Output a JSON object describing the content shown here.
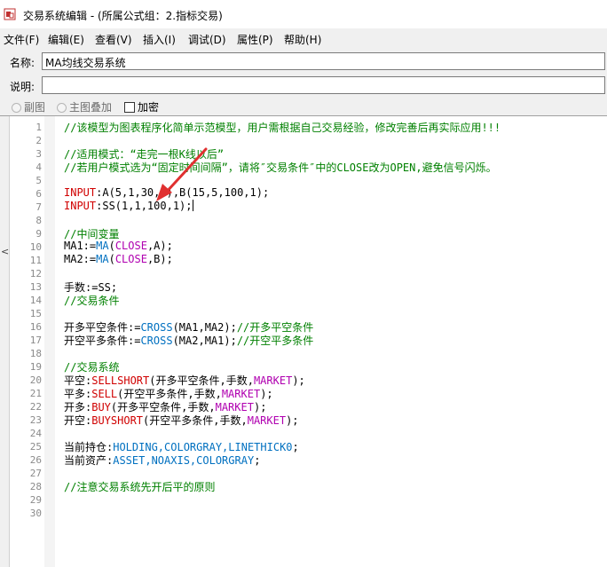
{
  "window": {
    "title": "交易系统编辑 - (所属公式组：2.指标交易)"
  },
  "menu": [
    {
      "label": "文件(F)"
    },
    {
      "label": "编辑(E)"
    },
    {
      "label": "查看(V)"
    },
    {
      "label": "插入(I)"
    },
    {
      "label": "调试(D)"
    },
    {
      "label": "属性(P)"
    },
    {
      "label": "帮助(H)"
    }
  ],
  "form": {
    "name_label": "名称:",
    "name_value": "MA均线交易系统",
    "desc_label": "说明:",
    "desc_value": "",
    "opt_subchart": "副图",
    "opt_mainoverlay": "主图叠加",
    "opt_encrypt": "加密"
  },
  "editor": {
    "line_numbers": [
      "1",
      "2",
      "3",
      "4",
      "5",
      "6",
      "7",
      "8",
      "9",
      "10",
      "11",
      "12",
      "13",
      "14",
      "15",
      "16",
      "17",
      "18",
      "19",
      "20",
      "21",
      "22",
      "23",
      "24",
      "25",
      "26",
      "27",
      "28",
      "29",
      "30"
    ],
    "line1": "//该模型为图表程序化简单示范模型，用户需根据自己交易经验，修改完善后再实际应用!!!",
    "line3": "//适用模式：“走完一根K线以后”",
    "line4": "//若用户模式选为“固定时间间隔”，请将″交易条件″中的CLOSE改为OPEN,避免信号闪烁。",
    "line6_kw": "INPUT",
    "line6_rest": ":A(5,1,30,1),B(15,5,100,1);",
    "line7_kw": "INPUT",
    "line7_rest": ":SS(1,1,100,1);",
    "line9": "//中间变量",
    "line10_a": "MA1:=",
    "line10_fn": "MA",
    "line10_b": "(",
    "line10_c": "CLOSE",
    "line10_d": ",A);",
    "line11_a": "MA2:=",
    "line11_fn": "MA",
    "line11_b": "(",
    "line11_c": "CLOSE",
    "line11_d": ",B);",
    "line13": "手数:=SS;",
    "line14": "//交易条件",
    "line16_a": "开多平空条件:=",
    "line16_fn": "CROSS",
    "line16_b": "(MA1,MA2);",
    "line16_c": "//开多平空条件",
    "line17_a": "开空平多条件:=",
    "line17_fn": "CROSS",
    "line17_b": "(MA2,MA1);",
    "line17_c": "//开空平多条件",
    "line19": "//交易系统",
    "line20_a": "平空:",
    "line20_fn": "SELLSHORT",
    "line20_b": "(开多平空条件,手数,",
    "line20_c": "MARKET",
    "line20_d": ");",
    "line21_a": "平多:",
    "line21_fn": "SELL",
    "line21_b": "(开空平多条件,手数,",
    "line21_c": "MARKET",
    "line21_d": ");",
    "line22_a": "开多:",
    "line22_fn": "BUY",
    "line22_b": "(开多平空条件,手数,",
    "line22_c": "MARKET",
    "line22_d": ");",
    "line23_a": "开空:",
    "line23_fn": "BUYSHORT",
    "line23_b": "(开空平多条件,手数,",
    "line23_c": "MARKET",
    "line23_d": ");",
    "line25_a": "当前持仓:",
    "line25_b": "HOLDING,COLORGRAY,LINETHICK0",
    "line25_c": ";",
    "line26_a": "当前资产:",
    "line26_b": "ASSET,NOAXIS,COLORGRAY",
    "line26_c": ";",
    "line28": "//注意交易系统先开后平的原则"
  },
  "colors": {
    "comment": "#008000",
    "keyword_red": "#d00000",
    "function_blue": "#0070c0",
    "constant_magenta": "#b000b0",
    "annotation_arrow": "#e03030"
  }
}
